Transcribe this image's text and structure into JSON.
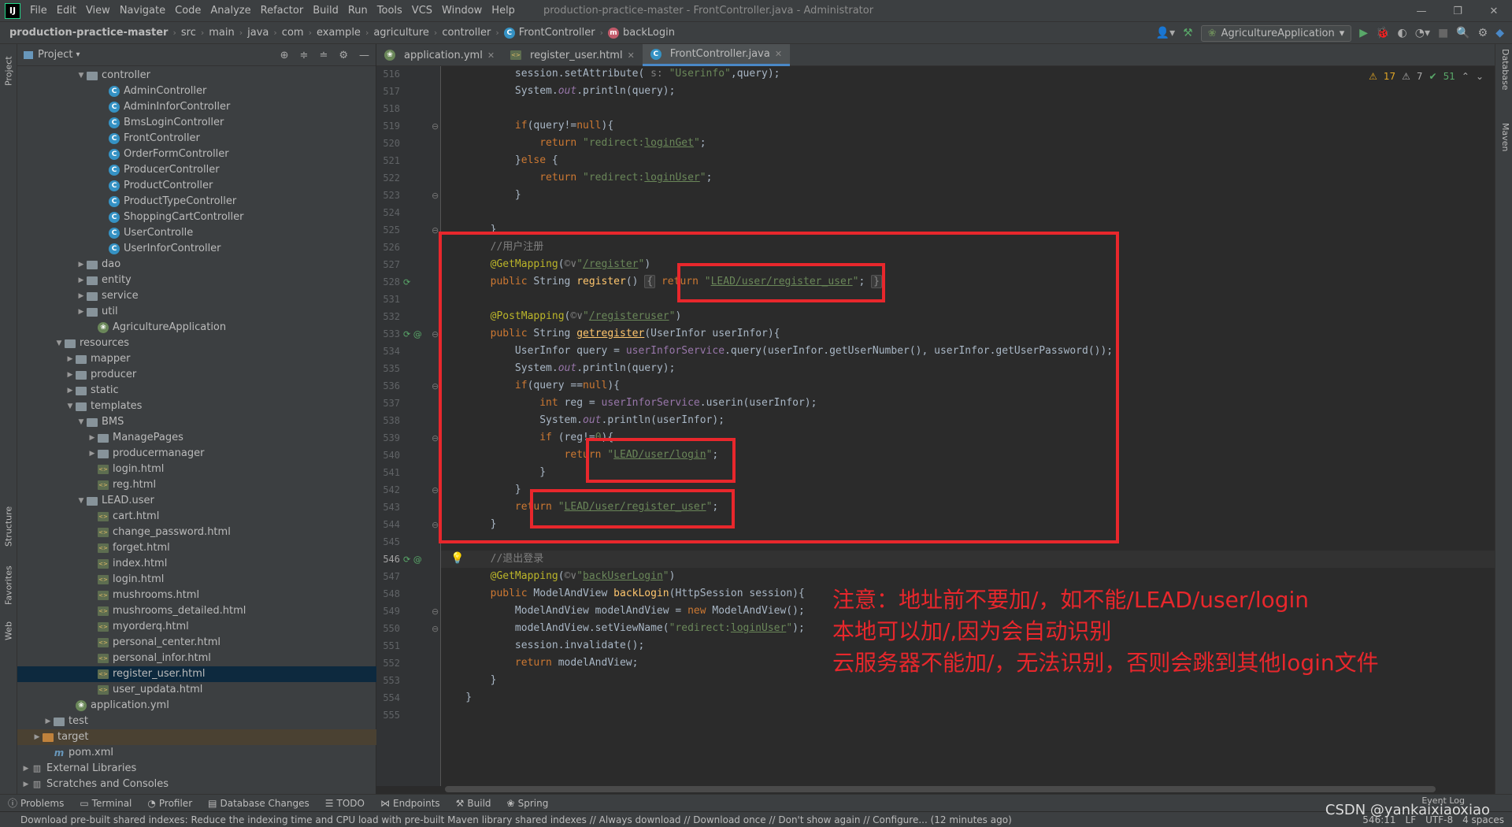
{
  "menubar": {
    "logo": "IJ",
    "items": [
      "File",
      "Edit",
      "View",
      "Navigate",
      "Code",
      "Analyze",
      "Refactor",
      "Build",
      "Run",
      "Tools",
      "VCS",
      "Window",
      "Help"
    ],
    "title": "production-practice-master - FrontController.java - Administrator"
  },
  "breadcrumb": [
    "production-practice-master",
    "src",
    "main",
    "java",
    "com",
    "example",
    "agriculture",
    "controller",
    "FrontController",
    "backLogin"
  ],
  "run_config": "AgricultureApplication",
  "project_panel": {
    "title": "Project"
  },
  "tree": [
    {
      "label": "controller",
      "indent": 5,
      "icon": "folder",
      "arrow": "v"
    },
    {
      "label": "AdminController",
      "indent": 7,
      "icon": "class"
    },
    {
      "label": "AdminInforController",
      "indent": 7,
      "icon": "class"
    },
    {
      "label": "BmsLoginController",
      "indent": 7,
      "icon": "class"
    },
    {
      "label": "FrontController",
      "indent": 7,
      "icon": "class"
    },
    {
      "label": "OrderFormController",
      "indent": 7,
      "icon": "class"
    },
    {
      "label": "ProducerController",
      "indent": 7,
      "icon": "class"
    },
    {
      "label": "ProductController",
      "indent": 7,
      "icon": "class"
    },
    {
      "label": "ProductTypeController",
      "indent": 7,
      "icon": "class"
    },
    {
      "label": "ShoppingCartController",
      "indent": 7,
      "icon": "class"
    },
    {
      "label": "UserControlle",
      "indent": 7,
      "icon": "class"
    },
    {
      "label": "UserInforController",
      "indent": 7,
      "icon": "class"
    },
    {
      "label": "dao",
      "indent": 5,
      "icon": "folder",
      "arrow": ">"
    },
    {
      "label": "entity",
      "indent": 5,
      "icon": "folder",
      "arrow": ">"
    },
    {
      "label": "service",
      "indent": 5,
      "icon": "folder",
      "arrow": ">"
    },
    {
      "label": "util",
      "indent": 5,
      "icon": "folder",
      "arrow": ">"
    },
    {
      "label": "AgricultureApplication",
      "indent": 6,
      "icon": "spring"
    },
    {
      "label": "resources",
      "indent": 3,
      "icon": "folder",
      "arrow": "v"
    },
    {
      "label": "mapper",
      "indent": 4,
      "icon": "folder",
      "arrow": ">"
    },
    {
      "label": "producer",
      "indent": 4,
      "icon": "folder",
      "arrow": ">"
    },
    {
      "label": "static",
      "indent": 4,
      "icon": "folder",
      "arrow": ">"
    },
    {
      "label": "templates",
      "indent": 4,
      "icon": "folder",
      "arrow": "v"
    },
    {
      "label": "BMS",
      "indent": 5,
      "icon": "folder",
      "arrow": "v"
    },
    {
      "label": "ManagePages",
      "indent": 6,
      "icon": "folder",
      "arrow": ">"
    },
    {
      "label": "producermanager",
      "indent": 6,
      "icon": "folder",
      "arrow": ">"
    },
    {
      "label": "login.html",
      "indent": 6,
      "icon": "html"
    },
    {
      "label": "reg.html",
      "indent": 6,
      "icon": "html"
    },
    {
      "label": "LEAD.user",
      "indent": 5,
      "icon": "folder",
      "arrow": "v"
    },
    {
      "label": "cart.html",
      "indent": 6,
      "icon": "html"
    },
    {
      "label": "change_password.html",
      "indent": 6,
      "icon": "html"
    },
    {
      "label": "forget.html",
      "indent": 6,
      "icon": "html"
    },
    {
      "label": "index.html",
      "indent": 6,
      "icon": "html"
    },
    {
      "label": "login.html",
      "indent": 6,
      "icon": "html"
    },
    {
      "label": "mushrooms.html",
      "indent": 6,
      "icon": "html"
    },
    {
      "label": "mushrooms_detailed.html",
      "indent": 6,
      "icon": "html"
    },
    {
      "label": "myorderq.html",
      "indent": 6,
      "icon": "html"
    },
    {
      "label": "personal_center.html",
      "indent": 6,
      "icon": "html"
    },
    {
      "label": "personal_infor.html",
      "indent": 6,
      "icon": "html"
    },
    {
      "label": "register_user.html",
      "indent": 6,
      "icon": "html",
      "selected": true
    },
    {
      "label": "user_updata.html",
      "indent": 6,
      "icon": "html"
    },
    {
      "label": "application.yml",
      "indent": 4,
      "icon": "spring"
    },
    {
      "label": "test",
      "indent": 2,
      "icon": "folder",
      "arrow": ">"
    },
    {
      "label": "target",
      "indent": 1,
      "icon": "folder-orange",
      "arrow": ">",
      "target": true
    },
    {
      "label": "pom.xml",
      "indent": 2,
      "icon": "maven"
    },
    {
      "label": "External Libraries",
      "indent": 0,
      "icon": "lib",
      "arrow": ">"
    },
    {
      "label": "Scratches and Consoles",
      "indent": 0,
      "icon": "lib",
      "arrow": ">"
    }
  ],
  "tabs": [
    {
      "label": "application.yml",
      "icon": "spring"
    },
    {
      "label": "register_user.html",
      "icon": "html"
    },
    {
      "label": "FrontController.java",
      "icon": "class",
      "active": true
    }
  ],
  "inspections": {
    "warnings": "17",
    "weak": "7",
    "ok": "51"
  },
  "code_lines": [
    {
      "n": "516",
      "html": "            session.setAttribute( <span class=\"cmt\">s:</span> <span class=\"str\">\"Userinfo\"</span>,query);"
    },
    {
      "n": "517",
      "html": "            System.<span class=\"fld itl\">out</span>.println(query);"
    },
    {
      "n": "518",
      "html": ""
    },
    {
      "n": "519",
      "html": "            <span class=\"kw\">if</span>(query!=<span class=\"kw\">null</span>){"
    },
    {
      "n": "520",
      "html": "                <span class=\"kw\">return</span> <span class=\"str\">\"redirect:<span class=\"ul\">loginGet</span>\"</span>;"
    },
    {
      "n": "521",
      "html": "            }<span class=\"kw\">else</span> {"
    },
    {
      "n": "522",
      "html": "                <span class=\"kw\">return</span> <span class=\"str\">\"redirect:<span class=\"ul\">loginUser</span>\"</span>;"
    },
    {
      "n": "523",
      "html": "            }"
    },
    {
      "n": "524",
      "html": ""
    },
    {
      "n": "525",
      "html": "        }"
    },
    {
      "n": "526",
      "html": "        <span class=\"cmt\">//用户注册</span>"
    },
    {
      "n": "527",
      "html": "        <span class=\"ann\">@GetMapping</span>(<span class=\"cmt\">©∨</span><span class=\"str\">\"<span class=\"ul\">/register</span>\"</span>)"
    },
    {
      "n": "528",
      "html": "        <span class=\"kw\">public</span> String <span class=\"mth\">register</span>() <span class=\"fold\">{</span> <span class=\"kw\">return</span> <span class=\"str\">\"<span class=\"ul\">LEAD/user/register_user</span>\"</span>; <span class=\"fold\">}</span>"
    },
    {
      "n": "531",
      "html": ""
    },
    {
      "n": "532",
      "html": "        <span class=\"ann\">@PostMapping</span>(<span class=\"cmt\">©∨</span><span class=\"str\">\"<span class=\"ul\">/registeruser</span>\"</span>)"
    },
    {
      "n": "533",
      "html": "        <span class=\"kw\">public</span> String <span class=\"mth ul\">getregister</span>(UserInfor userInfor){"
    },
    {
      "n": "534",
      "html": "            UserInfor query = <span class=\"fld\">userInforService</span>.query(userInfor.getUserNumber(), userInfor.getUserPassword());"
    },
    {
      "n": "535",
      "html": "            System.<span class=\"fld itl\">out</span>.println(query);"
    },
    {
      "n": "536",
      "html": "            <span class=\"kw\">if</span>(query ==<span class=\"kw\">null</span>){"
    },
    {
      "n": "537",
      "html": "                <span class=\"kw\">int</span> reg = <span class=\"fld\">userInforService</span>.userin(userInfor);"
    },
    {
      "n": "538",
      "html": "                System.<span class=\"fld itl\">out</span>.println(userInfor);"
    },
    {
      "n": "539",
      "html": "                <span class=\"kw\">if</span> (reg!=<span class=\"str\">0</span>){"
    },
    {
      "n": "540",
      "html": "                    <span class=\"kw\">return</span> <span class=\"str\">\"<span class=\"ul\">LEAD/user/login</span>\"</span>;"
    },
    {
      "n": "541",
      "html": "                }"
    },
    {
      "n": "542",
      "html": "            }"
    },
    {
      "n": "543",
      "html": "            <span class=\"kw\">return</span> <span class=\"str\">\"<span class=\"ul\">LEAD/user/register_user</span>\"</span>;"
    },
    {
      "n": "544",
      "html": "        }"
    },
    {
      "n": "545",
      "html": ""
    },
    {
      "n": "546",
      "html": "        <span class=\"cmt\">//退出登录</span>",
      "current": true
    },
    {
      "n": "547",
      "html": "        <span class=\"ann\">@GetMapping</span>(<span class=\"cmt\">©∨</span><span class=\"str\">\"<span class=\"ul\">backUserLogin</span>\"</span>)"
    },
    {
      "n": "548",
      "html": "        <span class=\"kw\">public</span> ModelAndView <span class=\"mth\">backLogin</span>(HttpSession session){"
    },
    {
      "n": "549",
      "html": "            ModelAndView modelAndView = <span class=\"kw\">new</span> ModelAndView();"
    },
    {
      "n": "550",
      "html": "            modelAndView.setViewName(<span class=\"str\">\"redirect:<span class=\"ul\">loginUser</span>\"</span>);"
    },
    {
      "n": "551",
      "html": "            session.invalidate();"
    },
    {
      "n": "552",
      "html": "            <span class=\"kw\">return</span> modelAndView;"
    },
    {
      "n": "553",
      "html": "        }"
    },
    {
      "n": "554",
      "html": "    }"
    },
    {
      "n": "555",
      "html": ""
    }
  ],
  "note_lines": [
    "注意：地址前不要加/，如不能/LEAD/user/login",
    "本地可以加/,因为会自动识别",
    "云服务器不能加/，无法识别，否则会跳到其他login文件"
  ],
  "bottom_tabs": [
    "Problems",
    "Terminal",
    "Profiler",
    "Database Changes",
    "TODO",
    "Endpoints",
    "Build",
    "Spring"
  ],
  "left_vtabs": [
    "Project",
    "Structure",
    "Favorites",
    "Web"
  ],
  "right_vtabs": [
    "Database",
    "Maven"
  ],
  "status": {
    "text": "Download pre-built shared indexes: Reduce the indexing time and CPU load with pre-built Maven library shared indexes // Always download // Download once // Don't show again // Configure... (12 minutes ago)",
    "position": "546:11",
    "lf": "LF",
    "encoding": "UTF-8",
    "indent": "4 spaces",
    "event_log": "Event Log"
  },
  "watermark": "CSDN @yankaixiaoxiao",
  "colors": {
    "accent": "#4a88c7",
    "annotation_red": "#e8272c"
  }
}
